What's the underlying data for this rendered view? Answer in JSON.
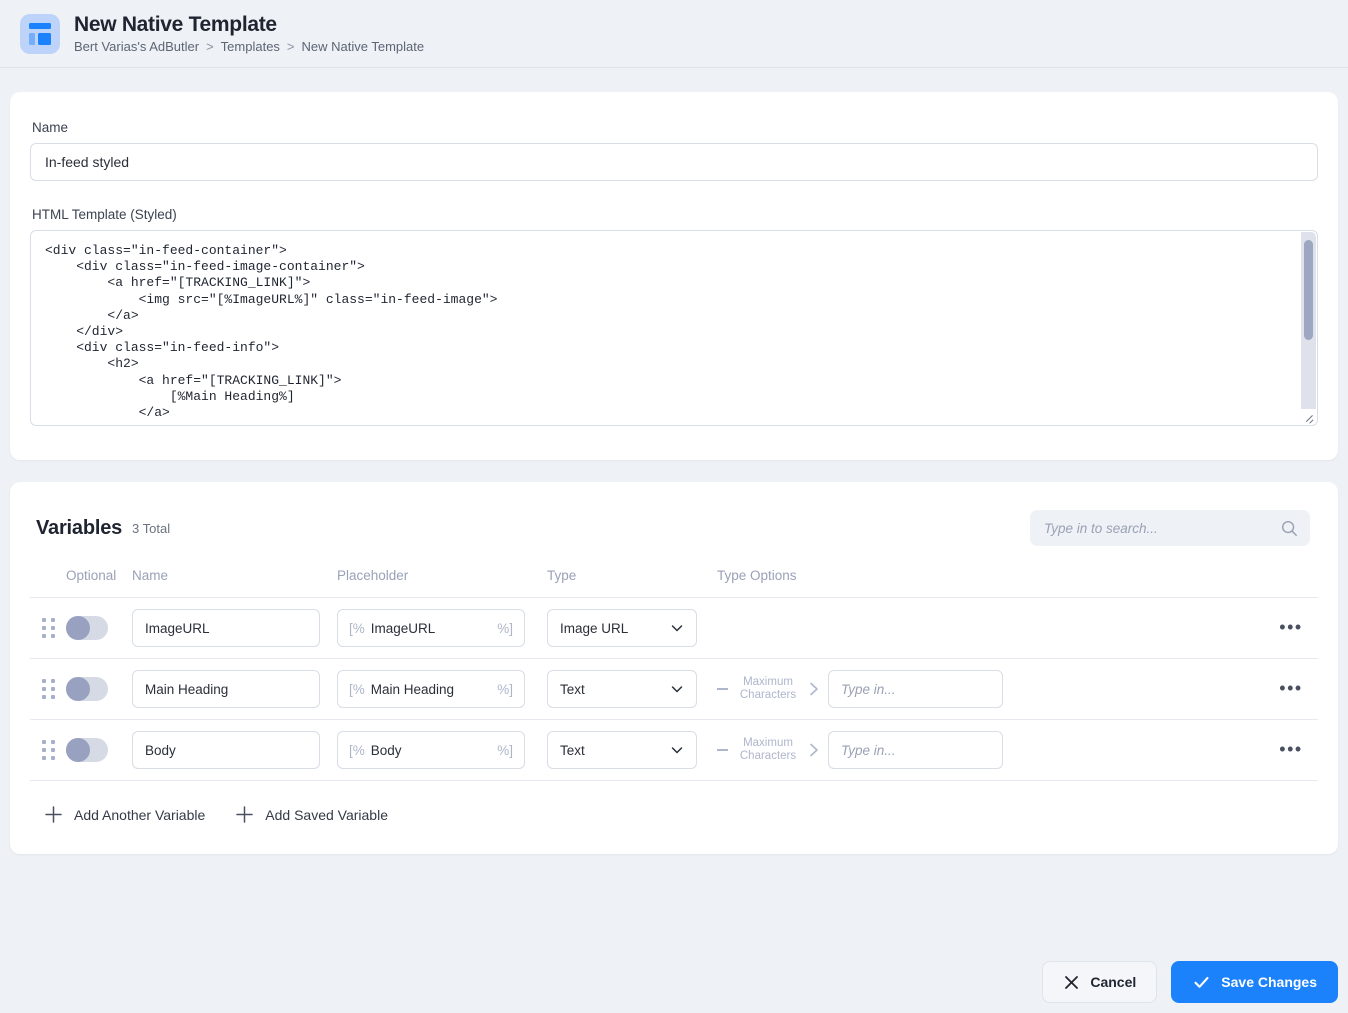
{
  "header": {
    "icon": "template-layout-icon",
    "title": "New Native Template",
    "breadcrumb": [
      {
        "label": "Bert Varias's AdButler"
      },
      {
        "label": "Templates"
      },
      {
        "label": "New Native Template"
      }
    ],
    "breadcrumb_separator": ">"
  },
  "form": {
    "name_label": "Name",
    "name_value": "In-feed styled",
    "name_placeholder": "Name",
    "html_label": "HTML Template (Styled)",
    "html_value": "<div class=\"in-feed-container\">\n    <div class=\"in-feed-image-container\">\n        <a href=\"[TRACKING_LINK]\">\n            <img src=\"[%ImageURL%]\" class=\"in-feed-image\">\n        </a>\n    </div>\n    <div class=\"in-feed-info\">\n        <h2>\n            <a href=\"[TRACKING_LINK]\">\n                [%Main Heading%]\n            </a>"
  },
  "variables": {
    "title": "Variables",
    "count_label": "3 Total",
    "search_placeholder": "Type in to search...",
    "search_value": "",
    "columns": {
      "optional": "Optional",
      "name": "Name",
      "placeholder": "Placeholder",
      "type": "Type",
      "type_options": "Type Options"
    },
    "placeholder_open": "[%",
    "placeholder_close": "%]",
    "max_chars_label_line1": "Maximum",
    "max_chars_label_line2": "Characters",
    "type_option_input_placeholder": "Type in...",
    "rows": [
      {
        "optional": false,
        "name": "ImageURL",
        "placeholder_name": "ImageURL",
        "type": "Image URL",
        "has_type_options": false,
        "type_option_value": ""
      },
      {
        "optional": false,
        "name": "Main Heading",
        "placeholder_name": "Main Heading",
        "type": "Text",
        "has_type_options": true,
        "type_option_value": ""
      },
      {
        "optional": false,
        "name": "Body",
        "placeholder_name": "Body",
        "type": "Text",
        "has_type_options": true,
        "type_option_value": ""
      }
    ],
    "add_another": "Add Another Variable",
    "add_saved": "Add Saved Variable"
  },
  "footer": {
    "cancel_label": "Cancel",
    "save_label": "Save Changes"
  },
  "colors": {
    "accent": "#1b82fb",
    "page_bg": "#eef1f5",
    "muted": "#9aa1b8"
  }
}
